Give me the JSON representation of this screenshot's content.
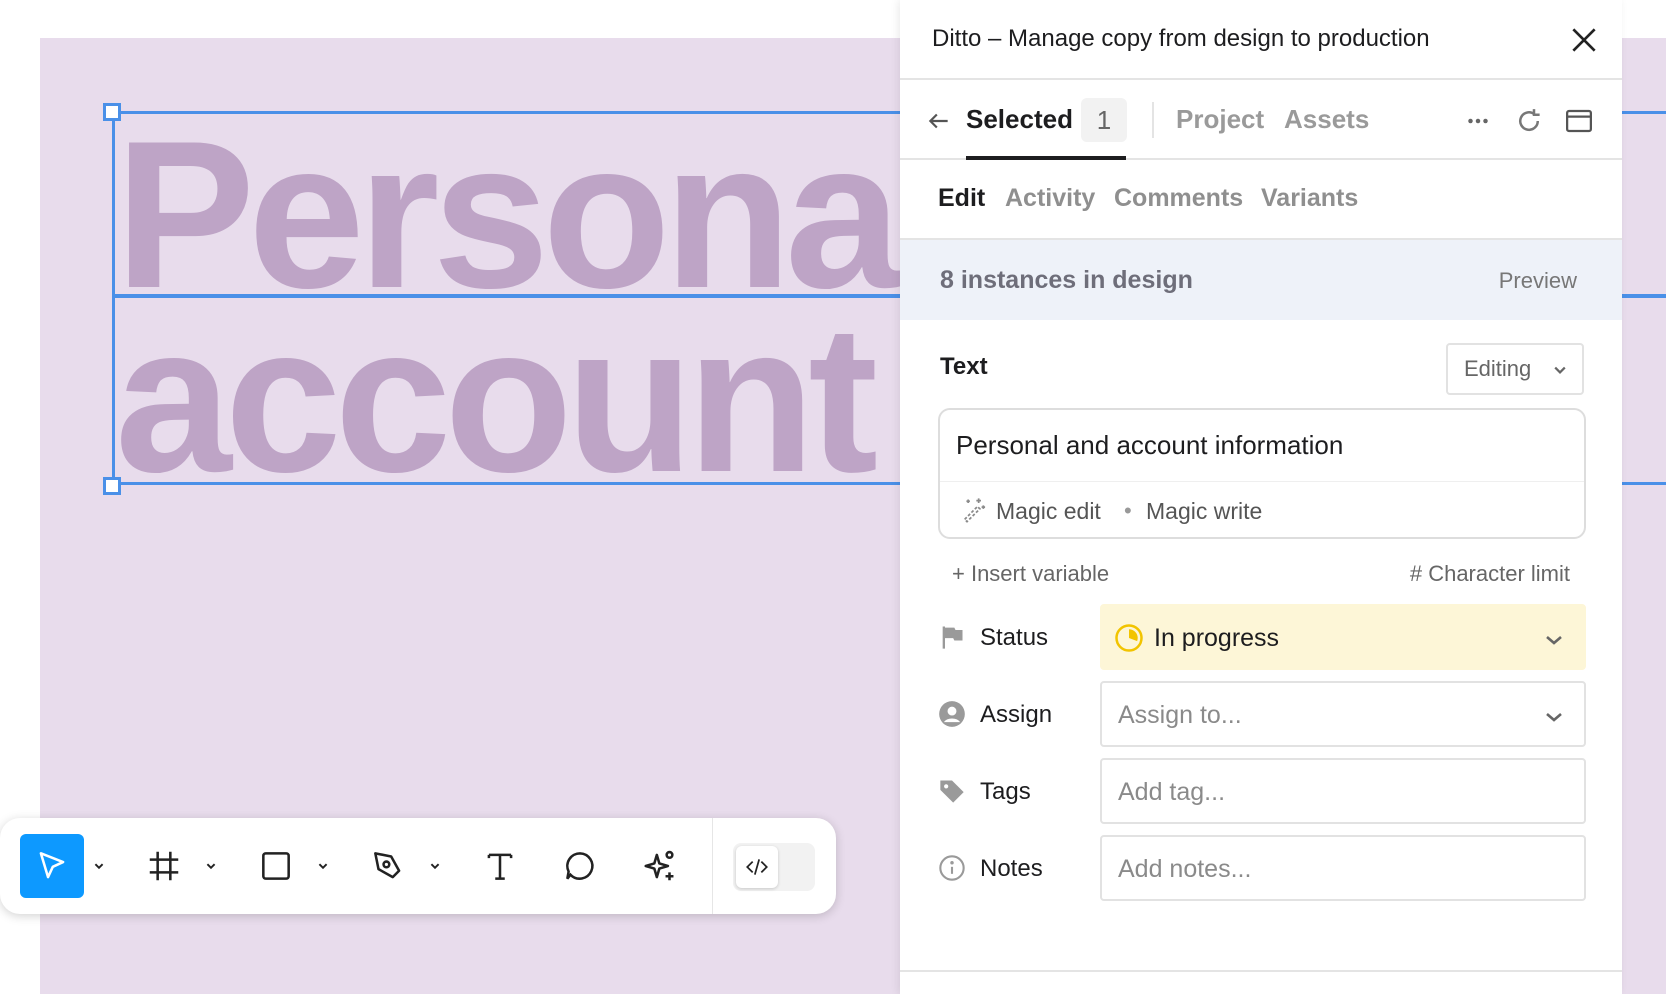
{
  "canvas": {
    "line1": "Persona",
    "line2": "account"
  },
  "panel": {
    "title": "Ditto – Manage copy from design to production",
    "nav": {
      "selected_label": "Selected",
      "selected_count": "1",
      "project_label": "Project",
      "assets_label": "Assets"
    },
    "subtabs": [
      "Edit",
      "Activity",
      "Comments",
      "Variants"
    ],
    "instances": {
      "text": "8 instances in design",
      "preview_label": "Preview"
    },
    "text_section": {
      "label": "Text",
      "mode": "Editing",
      "value": "Personal and account information",
      "magic_edit": "Magic edit",
      "separator": "•",
      "magic_write": "Magic write",
      "insert_variable": "+ Insert variable",
      "character_limit": "# Character limit"
    },
    "fields": {
      "status": {
        "label": "Status",
        "value": "In progress",
        "color": "#fdf6d7",
        "icon_color": "#f2c400"
      },
      "assign": {
        "label": "Assign",
        "placeholder": "Assign to..."
      },
      "tags": {
        "label": "Tags",
        "placeholder": "Add tag..."
      },
      "notes": {
        "label": "Notes",
        "placeholder": "Add notes..."
      }
    }
  },
  "toolbar": {
    "tools": [
      "move-tool",
      "frame-tool",
      "shape-tool",
      "pen-tool",
      "text-tool",
      "comment-tool",
      "actions-tool"
    ],
    "active_tool": "move-tool",
    "accent": "#0d99ff"
  },
  "colors": {
    "canvas_bg": "#e8dcec",
    "canvas_text": "#bea4c6",
    "selection": "#4a90e8"
  }
}
